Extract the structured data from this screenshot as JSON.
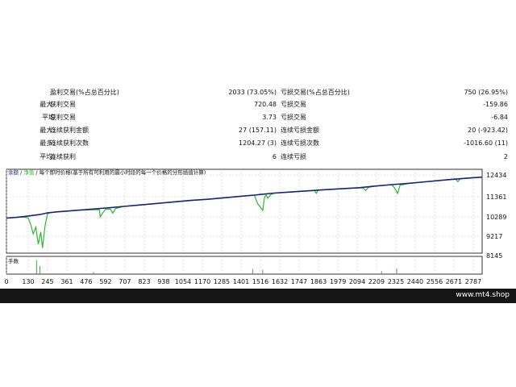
{
  "stats": {
    "rows": [
      {
        "label_a": "",
        "label_b": "盈利交易(%占总百分比)",
        "value_left": "2033 (73.05%)",
        "label_c": "亏损交易(%占总百分比)",
        "value_right": "750 (26.95%)"
      },
      {
        "label_a": "最大:",
        "label_b": "获利交易",
        "value_left": "720.48",
        "label_c": "亏损交易",
        "value_right": "-159.86"
      },
      {
        "label_a": "平均",
        "label_b": "获利交易",
        "value_left": "3.73",
        "label_c": "亏损交易",
        "value_right": "-6.84"
      },
      {
        "label_a": "最大:",
        "label_b": "连续获利金额",
        "value_left": "27 (157.11)",
        "label_c": "连续亏损金额",
        "value_right": "20 (-923.42)"
      },
      {
        "label_a": "最多:",
        "label_b": "连续获利次数",
        "value_left": "1204.27 (3)",
        "label_c": "连续亏损次数",
        "value_right": "-1016.60 (11)"
      },
      {
        "label_a": "平均:",
        "label_b": "连续获利",
        "value_left": "6",
        "label_c": "连续亏损",
        "value_right": "2"
      }
    ]
  },
  "chart": {
    "legend_balance": "余额",
    "legend_equity": "净值",
    "legend_desc": "每个即时价格(基于所有可利用的最小时段的每一个价格的分形插值计算)",
    "lots_label": "手数",
    "colors": {
      "balance": "#1a237e",
      "equity": "#2fb52f",
      "grid": "#c8c8c8",
      "frame": "#000000",
      "lots": "#2fb52f"
    }
  },
  "chart_data": {
    "type": "line",
    "x_ticks": [
      "0",
      "130",
      "245",
      "361",
      "476",
      "592",
      "707",
      "823",
      "938",
      "1054",
      "1170",
      "1285",
      "1401",
      "1516",
      "1632",
      "1747",
      "1863",
      "1979",
      "2094",
      "2209",
      "2325",
      "2440",
      "2556",
      "2671",
      "2787"
    ],
    "y_ticks": [
      "12434",
      "11361",
      "10289",
      "9217",
      "8145"
    ],
    "xlim": [
      0,
      2840
    ],
    "ylim": [
      8145,
      12434
    ],
    "series": [
      {
        "name": "余额",
        "x": [
          0,
          60,
          110,
          200,
          245,
          300,
          400,
          500,
          600,
          700,
          800,
          900,
          1000,
          1100,
          1200,
          1300,
          1400,
          1480,
          1520,
          1600,
          1700,
          1800,
          1900,
          2000,
          2100,
          2200,
          2300,
          2400,
          2500,
          2600,
          2700,
          2787,
          2840
        ],
        "y": [
          10140,
          10180,
          10230,
          10330,
          10420,
          10470,
          10540,
          10610,
          10680,
          10760,
          10840,
          10920,
          11000,
          11080,
          11140,
          11220,
          11300,
          11360,
          11400,
          11470,
          11530,
          11590,
          11650,
          11700,
          11750,
          11840,
          11920,
          11990,
          12070,
          12150,
          12230,
          12290,
          12320
        ]
      },
      {
        "name": "净值",
        "x": [
          0,
          60,
          100,
          130,
          145,
          160,
          175,
          190,
          205,
          215,
          230,
          245,
          260,
          280,
          300,
          400,
          520,
          555,
          560,
          570,
          590,
          620,
          635,
          650,
          700,
          800,
          900,
          1000,
          1100,
          1200,
          1300,
          1400,
          1480,
          1500,
          1530,
          1540,
          1550,
          1560,
          1580,
          1600,
          1700,
          1800,
          1840,
          1850,
          1860,
          1900,
          2000,
          2100,
          2130,
          2145,
          2160,
          2200,
          2300,
          2320,
          2335,
          2350,
          2380,
          2400,
          2500,
          2600,
          2680,
          2695,
          2710,
          2787,
          2840
        ],
        "y": [
          10140,
          10180,
          10200,
          10150,
          9800,
          9300,
          9650,
          8750,
          9400,
          8550,
          9700,
          10380,
          10420,
          10450,
          10470,
          10540,
          10580,
          10590,
          10200,
          10350,
          10600,
          10620,
          10400,
          10640,
          10760,
          10840,
          10920,
          11000,
          11080,
          11140,
          11220,
          11300,
          11360,
          10900,
          10550,
          11200,
          11380,
          11200,
          11400,
          11470,
          11530,
          11590,
          11600,
          11450,
          11620,
          11650,
          11700,
          11750,
          11740,
          11600,
          11770,
          11840,
          11920,
          11700,
          11450,
          11890,
          11940,
          11990,
          12070,
          12150,
          12230,
          12080,
          12240,
          12290,
          12320
        ]
      }
    ],
    "lots_spikes": [
      {
        "x": 180,
        "level": 0.95
      },
      {
        "x": 200,
        "level": 0.55
      },
      {
        "x": 520,
        "level": 0.15
      },
      {
        "x": 1470,
        "level": 0.35
      },
      {
        "x": 1530,
        "level": 0.3
      },
      {
        "x": 2240,
        "level": 0.2
      },
      {
        "x": 2330,
        "level": 0.4
      }
    ]
  },
  "footer": {
    "site": "www.mt4.shop"
  }
}
